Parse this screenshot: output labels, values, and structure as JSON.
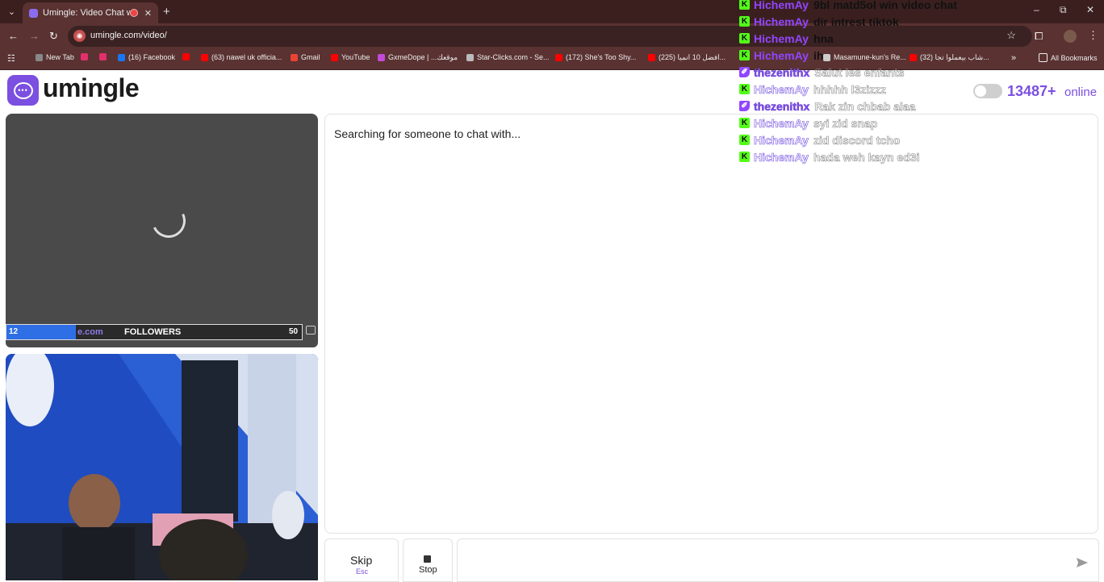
{
  "browser": {
    "tab_title": "Umingle: Video Chat with S",
    "url": "umingle.com/video/",
    "bookmarks": [
      {
        "label": "New Tab",
        "icon": "newtab-icon",
        "color": "#888888"
      },
      {
        "label": "",
        "icon": "instagram-icon",
        "color": "#e1306c"
      },
      {
        "label": "",
        "icon": "instagram-icon",
        "color": "#e1306c"
      },
      {
        "label": "(16) Facebook",
        "icon": "facebook-icon",
        "color": "#1877f2"
      },
      {
        "label": "",
        "icon": "youtube-icon",
        "color": "#ff0000"
      },
      {
        "label": "(63) nawel uk officia...",
        "icon": "youtube-icon",
        "color": "#ff0000"
      },
      {
        "label": "Gmail",
        "icon": "gmail-icon",
        "color": "#ea4335"
      },
      {
        "label": "YouTube",
        "icon": "youtube-icon",
        "color": "#ff0000"
      },
      {
        "label": "GxmeDope | ...موقعك",
        "icon": "gxmedope-icon",
        "color": "#c24bd8"
      },
      {
        "label": "Star-Clicks.com - Se...",
        "icon": "globe-icon",
        "color": "#bbbbbb"
      },
      {
        "label": "(172) She's Too Shy...",
        "icon": "youtube-icon",
        "color": "#ff0000"
      },
      {
        "label": "(225) افضل 10 انميا...",
        "icon": "youtube-icon",
        "color": "#ff0000"
      },
      {
        "label": "Masamune-kun's Re...",
        "icon": "bookmark-icon",
        "color": "#cccccc"
      },
      {
        "label": "(32) شاب بيعملوا تجا...",
        "icon": "youtube-icon",
        "color": "#ff0000"
      }
    ],
    "all_bookmarks": "All Bookmarks"
  },
  "site": {
    "logo_text": "umingle",
    "online_count": "13487+",
    "online_label": "online",
    "accent": "#7b4fe0"
  },
  "stranger": {
    "overlay_left_value": "12",
    "overlay_domain": "e.com",
    "overlay_label": "FOLLOWERS",
    "overlay_right_value": "50"
  },
  "chat": {
    "status": "Searching for someone to chat with..."
  },
  "controls": {
    "skip_label": "Skip",
    "skip_hint": "Esc",
    "stop_label": "Stop",
    "message_placeholder": ""
  },
  "stream_chat": [
    {
      "platform": "kick",
      "user": "HichemAy",
      "text": "9bl matd5ol win video chat",
      "faded": false
    },
    {
      "platform": "kick",
      "user": "HichemAy",
      "text": "dir intrest tiktok",
      "faded": false
    },
    {
      "platform": "kick",
      "user": "HichemAy",
      "text": "hna",
      "faded": false
    },
    {
      "platform": "kick",
      "user": "HichemAy",
      "text": "ih",
      "faded": false
    },
    {
      "platform": "twitch",
      "user": "thezenithx",
      "text": "Salut les enfants",
      "faded": true
    },
    {
      "platform": "kick",
      "user": "HichemAy",
      "text": "hhhhh l3zizzz",
      "faded": true
    },
    {
      "platform": "twitch",
      "user": "thezenithx",
      "text": "Rak zin chbab alaa",
      "faded": true
    },
    {
      "platform": "kick",
      "user": "HichemAy",
      "text": "syi zid snap",
      "faded": true
    },
    {
      "platform": "kick",
      "user": "HichemAy",
      "text": "zid discord tcho",
      "faded": true
    },
    {
      "platform": "kick",
      "user": "HichemAy",
      "text": "hada weh kayn ed3i",
      "faded": true
    }
  ]
}
